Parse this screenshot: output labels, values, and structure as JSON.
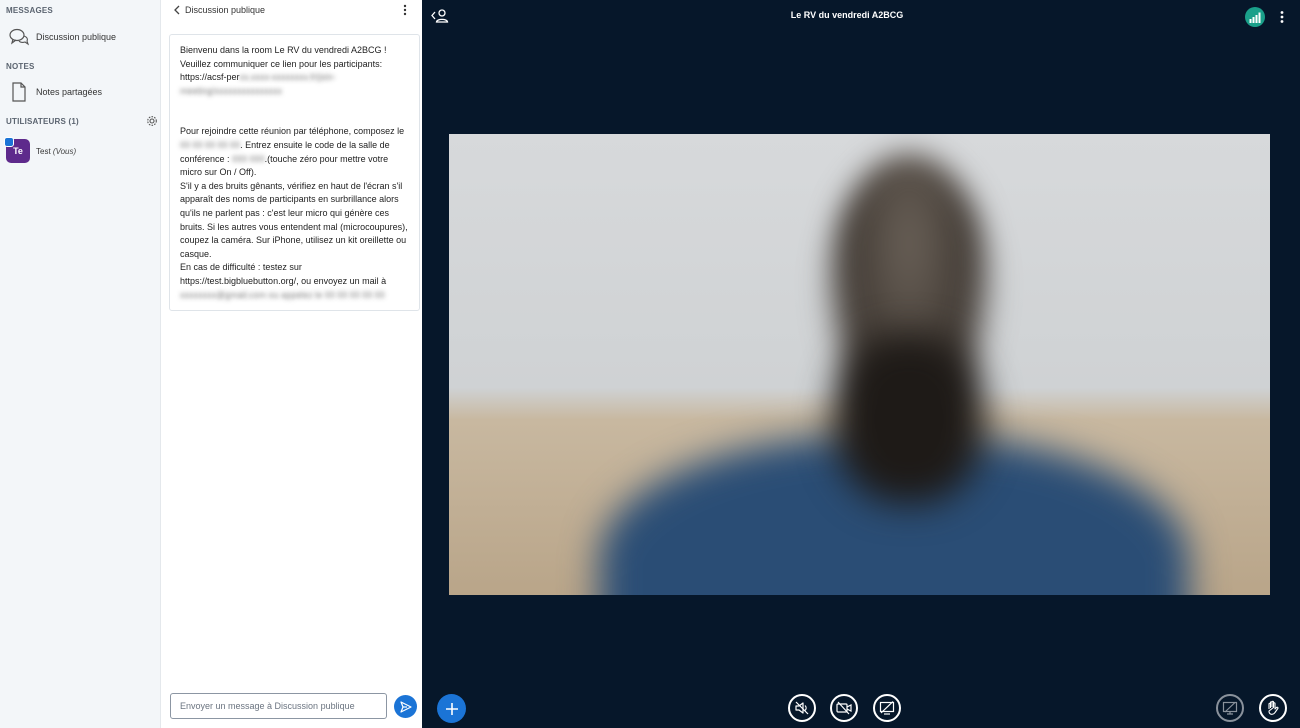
{
  "sidebar": {
    "messages_title": "MESSAGES",
    "public_chat_label": "Discussion publique",
    "notes_title": "NOTES",
    "shared_notes_label": "Notes partagées",
    "users_title": "UTILISATEURS (1)",
    "user": {
      "initials": "Te",
      "name": "Test",
      "you_label": "(Vous)"
    }
  },
  "chat": {
    "title": "Discussion publique",
    "welcome": {
      "line1": "Bienvenu dans la room Le RV du vendredi A2BCG !",
      "line2": "Veuillez communiquer ce lien pour les participants:",
      "link_prefix": "https://acsf-per",
      "phone_intro": "Pour rejoindre cette réunion par téléphone, composez le",
      "phone_mid": ". Entrez ensuite le code de la salle de conférence :",
      "phone_end": ".(touche zéro pour mettre votre micro sur On / Off).",
      "noise_tip": "S'il y a des bruits gênants, vérifiez en haut de l'écran s'il apparaît des noms de participants en surbrillance alors qu'ils ne parlent pas : c'est leur micro qui génère ces bruits. Si les autres vous entendent mal (microcoupures), coupez la caméra. Sur iPhone, utilisez un kit oreillette ou casque.",
      "difficulty": "En cas de difficulté : testez sur https://test.bigbluebutton.org/, ou envoyez un mail à"
    },
    "input_placeholder": "Envoyer un message à Discussion publique"
  },
  "main": {
    "meeting_title": "Le RV du vendredi A2BCG"
  },
  "colors": {
    "accent": "#1b74d6",
    "background": "#06172a",
    "connection": "#1aa08a",
    "avatar": "#5e2a8c"
  },
  "icons": {
    "public_chat": "chat-bubbles-icon",
    "shared_notes": "document-icon",
    "settings": "gear-icon",
    "users_toggle": "user-toggle-icon",
    "connection": "signal-bars-icon",
    "actions": "plus-icon",
    "audio": "speaker-muted-icon",
    "video": "camera-off-icon",
    "screenshare": "screenshare-off-icon",
    "presentation": "presentation-icon",
    "raise_hand": "hand-icon",
    "send": "send-icon"
  }
}
